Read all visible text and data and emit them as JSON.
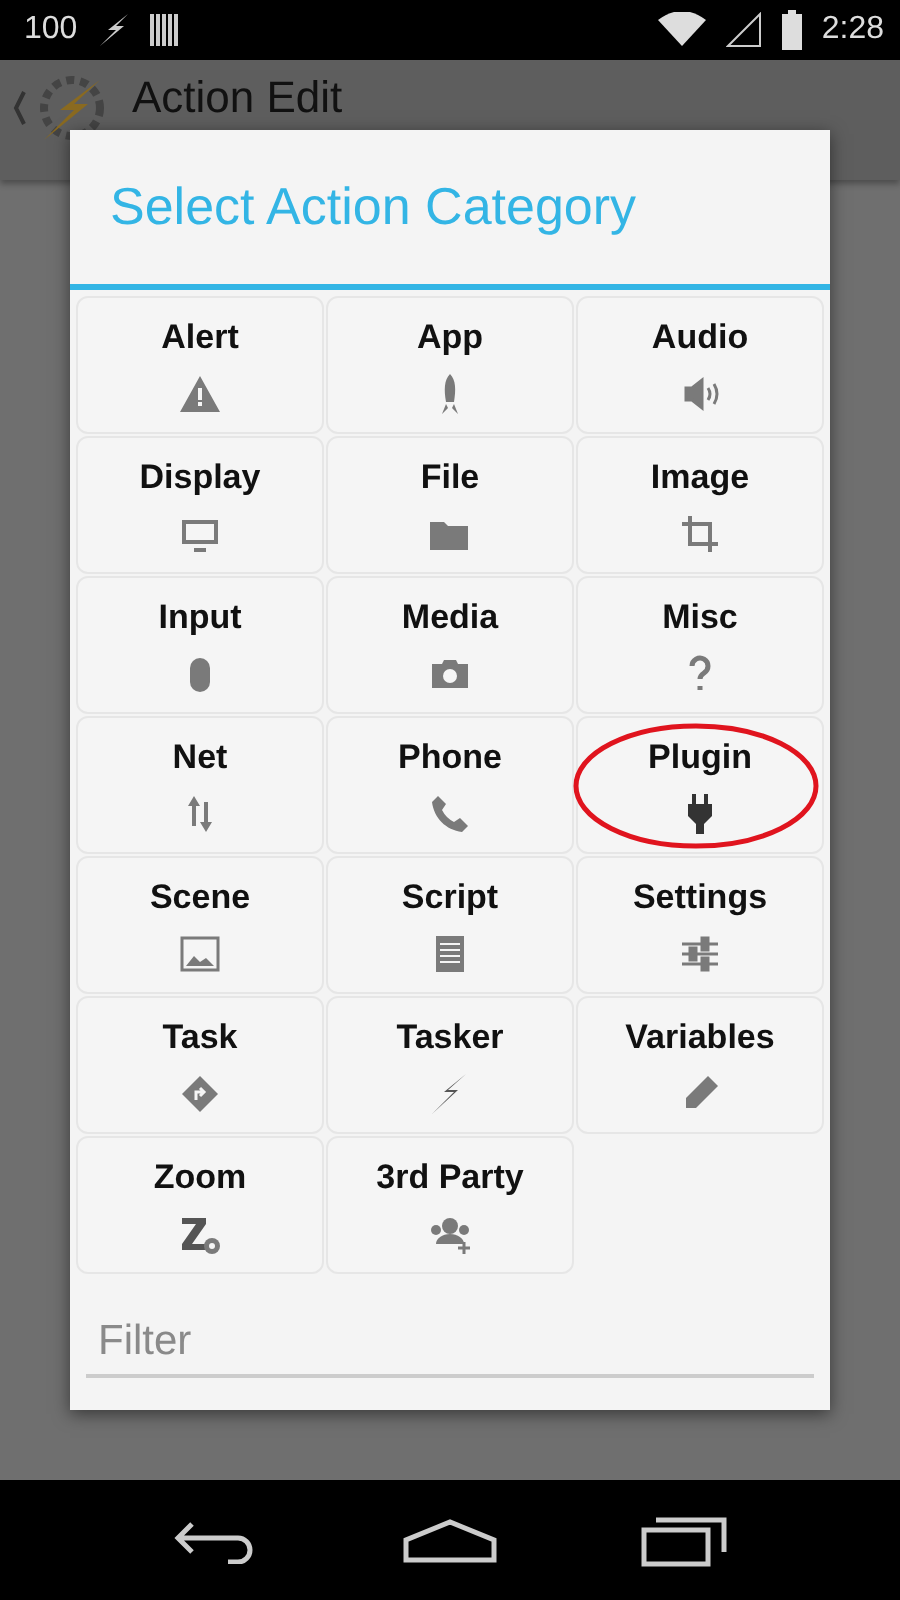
{
  "status_bar": {
    "battery_text": "100",
    "time": "2:28"
  },
  "action_bar": {
    "title": "Action Edit"
  },
  "dialog": {
    "title": "Select Action Category",
    "categories": [
      {
        "label": "Alert",
        "circled": false
      },
      {
        "label": "App",
        "circled": false
      },
      {
        "label": "Audio",
        "circled": false
      },
      {
        "label": "Display",
        "circled": false
      },
      {
        "label": "File",
        "circled": false
      },
      {
        "label": "Image",
        "circled": false
      },
      {
        "label": "Input",
        "circled": false
      },
      {
        "label": "Media",
        "circled": false
      },
      {
        "label": "Misc",
        "circled": false
      },
      {
        "label": "Net",
        "circled": false
      },
      {
        "label": "Phone",
        "circled": false
      },
      {
        "label": "Plugin",
        "circled": true
      },
      {
        "label": "Scene",
        "circled": false
      },
      {
        "label": "Script",
        "circled": false
      },
      {
        "label": "Settings",
        "circled": false
      },
      {
        "label": "Task",
        "circled": false
      },
      {
        "label": "Tasker",
        "circled": false
      },
      {
        "label": "Variables",
        "circled": false
      },
      {
        "label": "Zoom",
        "circled": false
      },
      {
        "label": "3rd Party",
        "circled": false
      }
    ],
    "filter": {
      "placeholder": "Filter"
    }
  }
}
